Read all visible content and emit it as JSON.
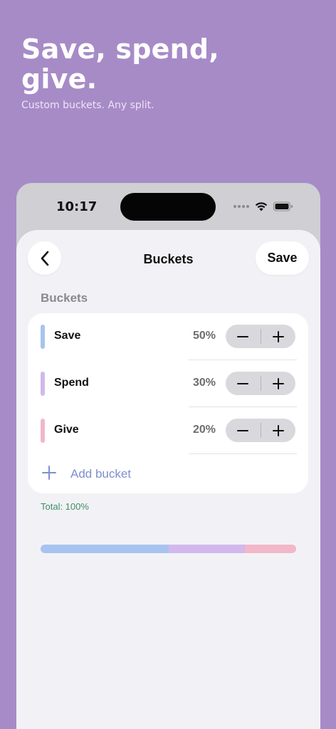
{
  "hero": {
    "title": "Save, spend,\ngive.",
    "subtitle": "Custom buckets. Any split."
  },
  "status_bar": {
    "time": "10:17",
    "icons": [
      "signal-dots-icon",
      "wifi-icon",
      "battery-icon"
    ]
  },
  "nav": {
    "title": "Buckets",
    "save_label": "Save",
    "back_icon": "chevron-left-icon"
  },
  "section_label": "Buckets",
  "buckets": [
    {
      "name": "Save",
      "percent": "50%",
      "value": 50,
      "color": "#a8c3f0"
    },
    {
      "name": "Spend",
      "percent": "30%",
      "value": 30,
      "color": "#d2b8ec"
    },
    {
      "name": "Give",
      "percent": "20%",
      "value": 20,
      "color": "#f2b7c8"
    }
  ],
  "stepper": {
    "minus_icon": "minus-icon",
    "plus_icon": "plus-icon"
  },
  "add_bucket": {
    "label": "Add bucket",
    "icon": "plus-icon"
  },
  "total": "Total: 100%",
  "colors": {
    "background": "#a78bc7",
    "sheet": "#f2f2f6",
    "accent": "#7f8fce",
    "total_text": "#3f8f64"
  }
}
